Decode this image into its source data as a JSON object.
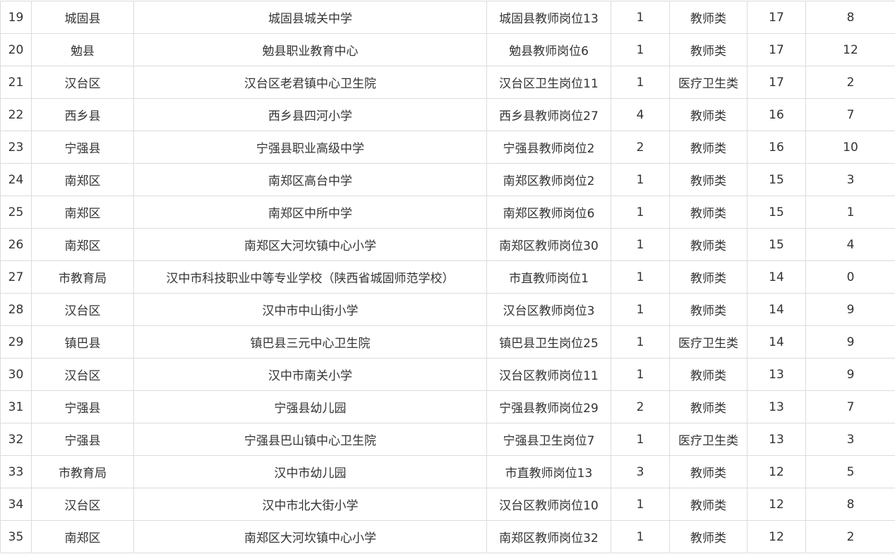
{
  "table": {
    "rows": [
      [
        "19",
        "城固县",
        "城固县城关中学",
        "城固县教师岗位13",
        "1",
        "教师类",
        "17",
        "8"
      ],
      [
        "20",
        "勉县",
        "勉县职业教育中心",
        "勉县教师岗位6",
        "1",
        "教师类",
        "17",
        "12"
      ],
      [
        "21",
        "汉台区",
        "汉台区老君镇中心卫生院",
        "汉台区卫生岗位11",
        "1",
        "医疗卫生类",
        "17",
        "2"
      ],
      [
        "22",
        "西乡县",
        "西乡县四河小学",
        "西乡县教师岗位27",
        "4",
        "教师类",
        "16",
        "7"
      ],
      [
        "23",
        "宁强县",
        "宁强县职业高级中学",
        "宁强县教师岗位2",
        "2",
        "教师类",
        "16",
        "10"
      ],
      [
        "24",
        "南郑区",
        "南郑区高台中学",
        "南郑区教师岗位2",
        "1",
        "教师类",
        "15",
        "3"
      ],
      [
        "25",
        "南郑区",
        "南郑区中所中学",
        "南郑区教师岗位6",
        "1",
        "教师类",
        "15",
        "1"
      ],
      [
        "26",
        "南郑区",
        "南郑区大河坎镇中心小学",
        "南郑区教师岗位30",
        "1",
        "教师类",
        "15",
        "4"
      ],
      [
        "27",
        "市教育局",
        "汉中市科技职业中等专业学校（陕西省城固师范学校）",
        "市直教师岗位1",
        "1",
        "教师类",
        "14",
        "0"
      ],
      [
        "28",
        "汉台区",
        "汉中市中山街小学",
        "汉台区教师岗位3",
        "1",
        "教师类",
        "14",
        "9"
      ],
      [
        "29",
        "镇巴县",
        "镇巴县三元中心卫生院",
        "镇巴县卫生岗位25",
        "1",
        "医疗卫生类",
        "14",
        "9"
      ],
      [
        "30",
        "汉台区",
        "汉中市南关小学",
        "汉台区教师岗位11",
        "1",
        "教师类",
        "13",
        "9"
      ],
      [
        "31",
        "宁强县",
        "宁强县幼儿园",
        "宁强县教师岗位29",
        "2",
        "教师类",
        "13",
        "7"
      ],
      [
        "32",
        "宁强县",
        "宁强县巴山镇中心卫生院",
        "宁强县卫生岗位7",
        "1",
        "医疗卫生类",
        "13",
        "3"
      ],
      [
        "33",
        "市教育局",
        "汉中市幼儿园",
        "市直教师岗位13",
        "3",
        "教师类",
        "12",
        "5"
      ],
      [
        "34",
        "汉台区",
        "汉中市北大街小学",
        "汉台区教师岗位10",
        "1",
        "教师类",
        "12",
        "8"
      ],
      [
        "35",
        "南郑区",
        "南郑区大河坎镇中心小学",
        "南郑区教师岗位32",
        "1",
        "教师类",
        "12",
        "2"
      ]
    ]
  }
}
